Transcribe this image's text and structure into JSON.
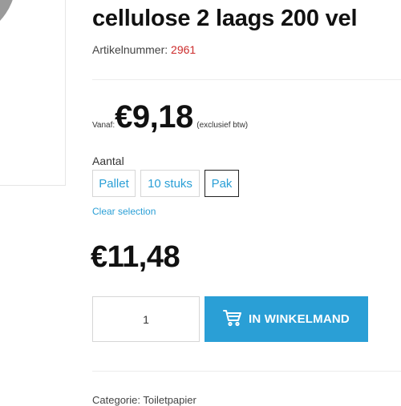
{
  "product": {
    "title": "cellulose 2 laags 200 vel",
    "sku_label": "Artikelnummer:",
    "sku_value": "2961"
  },
  "price_from": {
    "prefix": "Vanaf:",
    "amount": "€9,18",
    "suffix": "(exclusief btw)"
  },
  "quantity": {
    "label": "Aantal",
    "options": [
      "Pallet",
      "10 stuks",
      "Pak"
    ],
    "selected": "Pak",
    "clear_label": "Clear selection"
  },
  "price": "€11,48",
  "cart": {
    "qty_value": "1",
    "button_label": "IN WINKELMAND",
    "icon": "cart-icon"
  },
  "footer_partial": "Categorie:  Toiletpapier"
}
